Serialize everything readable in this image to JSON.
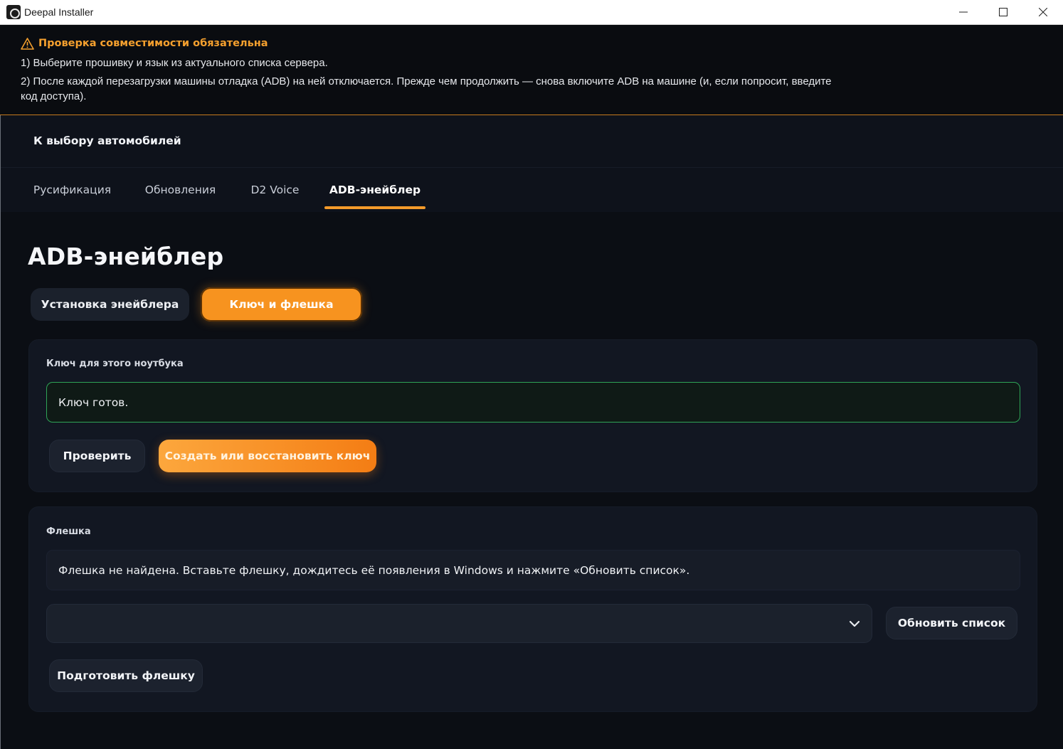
{
  "window": {
    "title": "Deepal Installer"
  },
  "banner": {
    "title": "Проверка совместимости обязательна",
    "line1": "1) Выберите прошивку и язык из актуального списка сервера.",
    "line2": "2) После каждой перезагрузки машины отладка (ADB) на ней отключается. Прежде чем продолжить — снова включите ADB на машине (и, если попросит, введите код доступа)."
  },
  "header": {
    "back_label": "К выбору автомобилей",
    "tabs": [
      {
        "label": "Русификация",
        "active": false
      },
      {
        "label": "Обновления",
        "active": false
      },
      {
        "label": "D2 Voice",
        "active": false
      },
      {
        "label": "ADB-энейблер",
        "active": true
      }
    ]
  },
  "page": {
    "title": "ADB-энейблер",
    "segments": [
      {
        "label": "Установка энейблера",
        "active": false
      },
      {
        "label": "Ключ и флешка",
        "active": true
      }
    ]
  },
  "key_card": {
    "label": "Ключ для этого ноутбука",
    "status": "Ключ готов.",
    "check_button": "Проверить",
    "create_button": "Создать или восстановить ключ"
  },
  "flash_card": {
    "label": "Флешка",
    "status": "Флешка не найдена. Вставьте флешку, дождитесь её появления в Windows и нажмите «Обновить список».",
    "select_value": "",
    "refresh_button": "Обновить список",
    "prepare_button": "Подготовить флешку"
  },
  "colors": {
    "accent": "#f7931f",
    "warning_text": "#f5a02e",
    "success_border": "#2fa457",
    "background": "#0b0e14",
    "card": "#121722"
  }
}
